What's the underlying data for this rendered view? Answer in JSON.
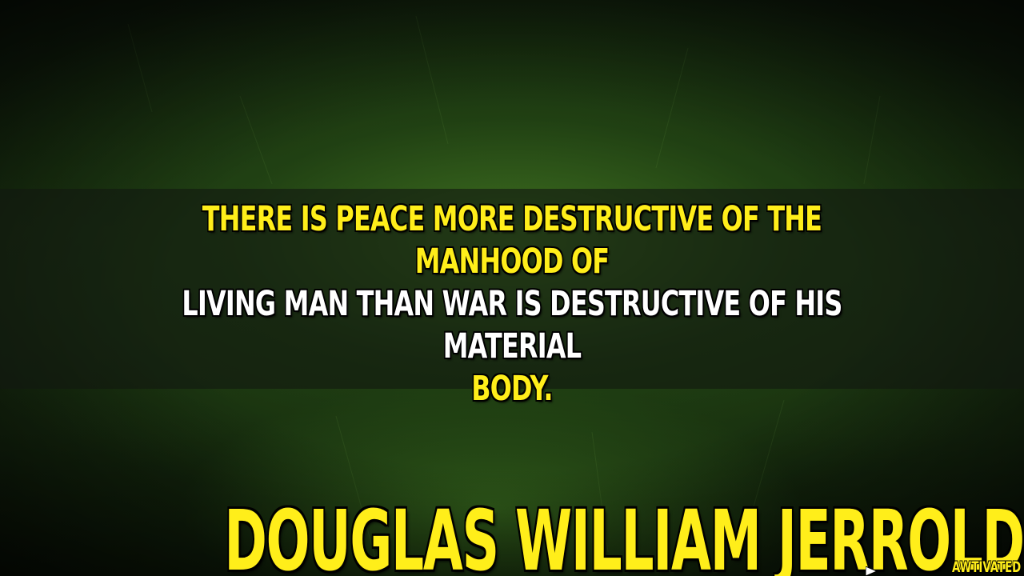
{
  "quote": {
    "line1": "THERE IS PEACE MORE DESTRUCTIVE OF THE MANHOOD OF",
    "line2": "LIVING MAN THAN WAR IS DESTRUCTIVE OF HIS MATERIAL",
    "line3": "BODY."
  },
  "author": "DOUGLAS WILLIAM JERROLD",
  "watermark": "AWTIVATED",
  "colors": {
    "highlight": "#ffee1a",
    "text": "#ffffff",
    "background": "#1a3212"
  }
}
